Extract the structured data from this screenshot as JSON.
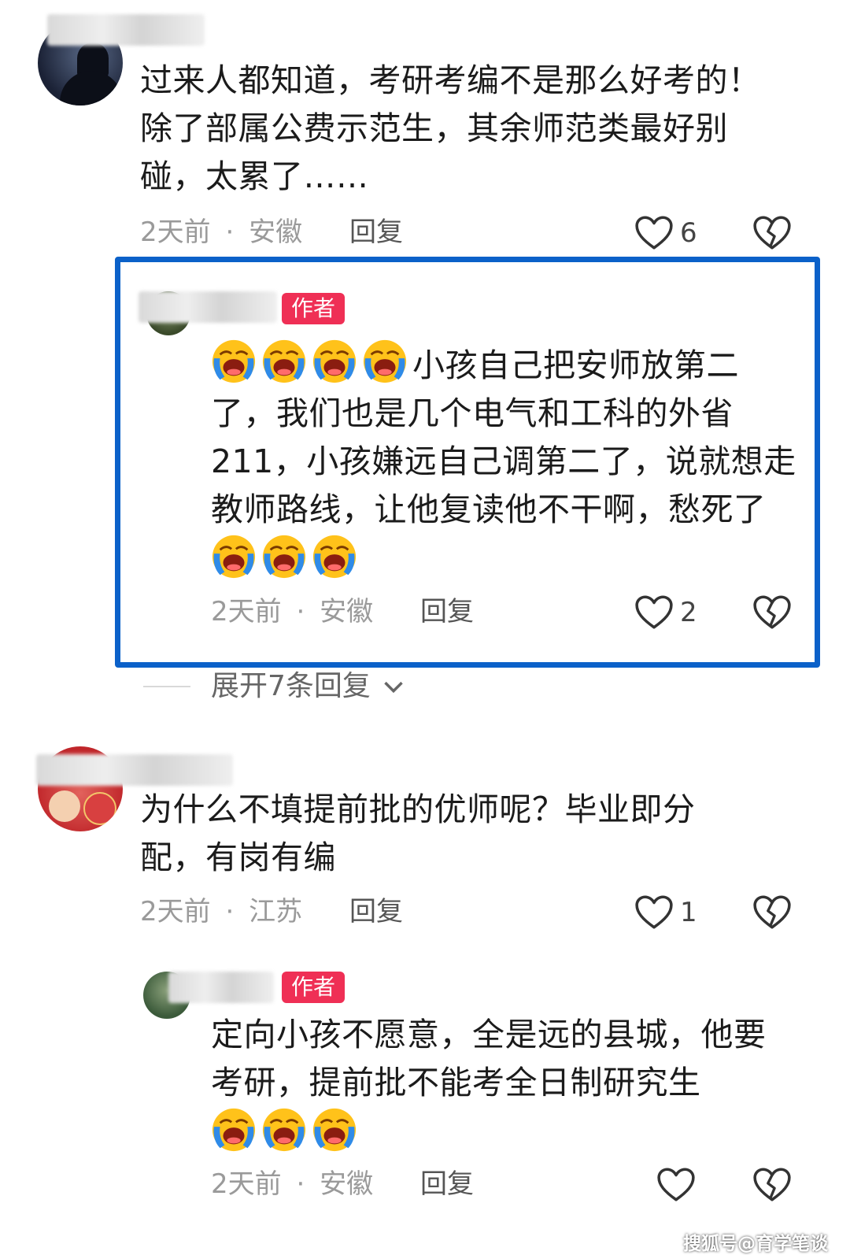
{
  "comments": [
    {
      "text": "过来人都知道，考研考编不是那么好考的！除了部属公费示范生，其余师范类最好别碰，太累了……",
      "time": "2天前",
      "location": "安徽",
      "reply_label": "回复",
      "likes": "6"
    },
    {
      "badge": "作者",
      "text": "小孩自己把安师放第二了，我们也是几个电气和工科的外省211，小孩嫌远自己调第二了，说就想走教师路线，让他复读他不干啊，愁死了",
      "time": "2天前",
      "location": "安徽",
      "reply_label": "回复",
      "likes": "2"
    },
    {
      "text": "为什么不填提前批的优师呢？毕业即分配，有岗有编",
      "time": "2天前",
      "location": "江苏",
      "reply_label": "回复",
      "likes": "1"
    },
    {
      "badge": "作者",
      "text": "定向小孩不愿意，全是远的县城，他要考研，提前批不能考全日制研究生",
      "time": "2天前",
      "location": "安徽",
      "reply_label": "回复",
      "likes": ""
    }
  ],
  "expand_label": "展开7条回复",
  "separator": "·",
  "watermark": "搜狐号@育学笔谈",
  "colors": {
    "highlight": "#0b61c9",
    "badge": "#ef2f55",
    "meta": "#9a9a9a"
  }
}
